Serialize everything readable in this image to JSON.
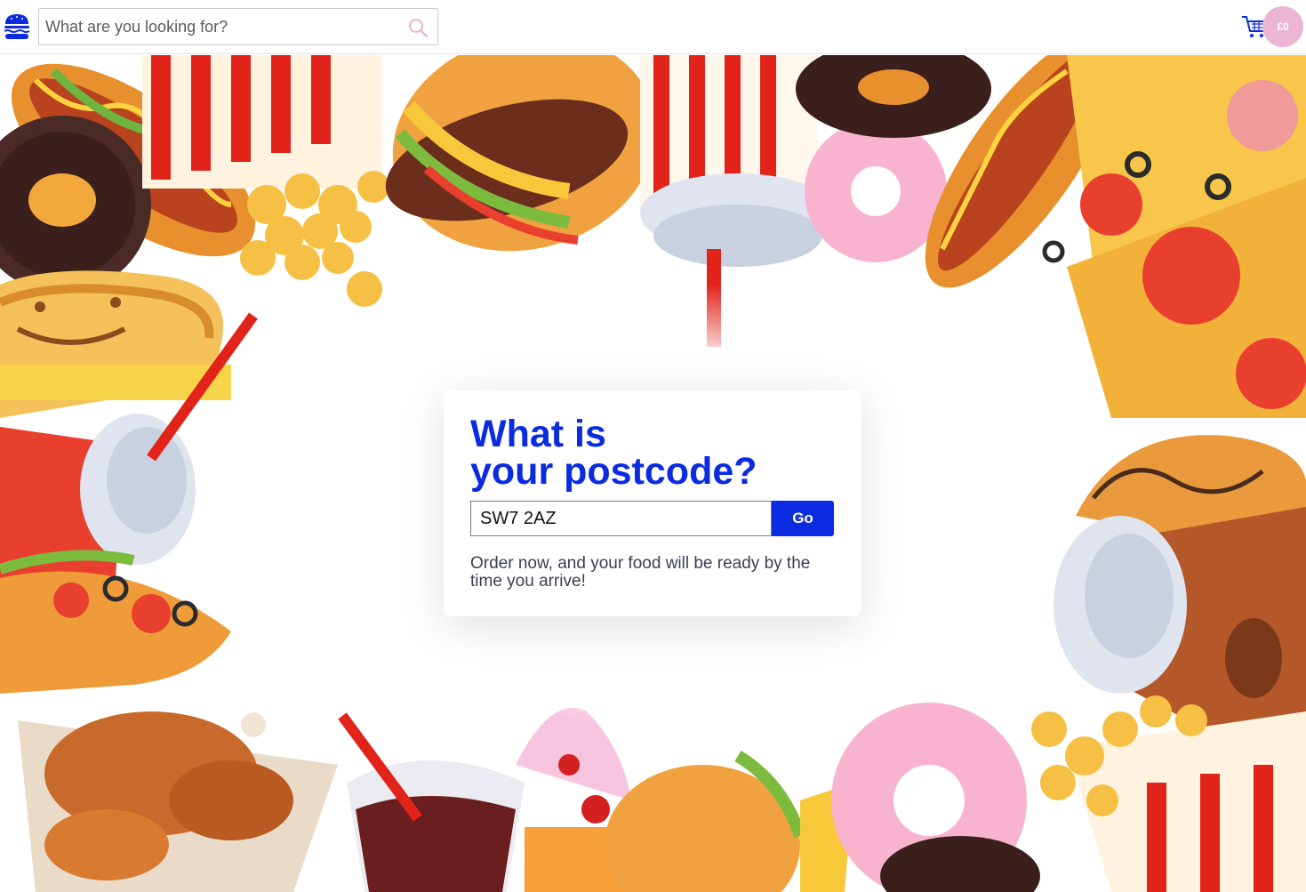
{
  "header": {
    "logo_icon": "burger-icon",
    "search": {
      "placeholder": "What are you looking for?",
      "value": "",
      "icon": "search-icon"
    },
    "cart": {
      "icon": "shopping-cart-icon",
      "total": "£0"
    }
  },
  "postcode_card": {
    "title_line1": "What is",
    "title_line2": "your postcode?",
    "input_value": "SW7 2AZ",
    "button_label": "Go",
    "description": "Order now, and your food will be ready by the time you arrive!"
  },
  "background": {
    "illustration": "fast-food-collage",
    "items": [
      "hot-dog",
      "donut",
      "fries",
      "burger",
      "soda-cup",
      "pizza",
      "sandwich",
      "popcorn",
      "croissant",
      "coffee-cup",
      "taco",
      "fried-chicken",
      "cola-glass",
      "ice-cream"
    ]
  },
  "colors": {
    "brand_blue": "#0b2be0",
    "cart_badge": "#ecb6d3",
    "search_icon": "#ec9ec6"
  }
}
